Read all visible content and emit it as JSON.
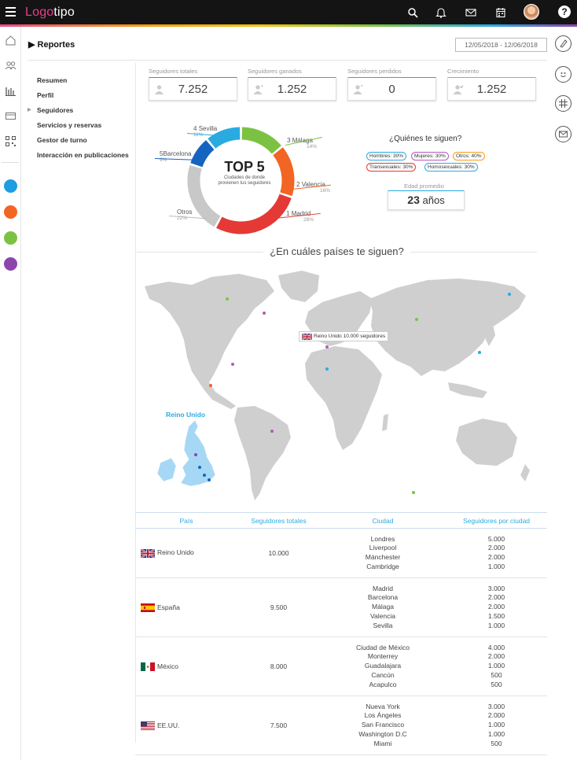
{
  "app": {
    "logo_part1": "Logo",
    "logo_part2": "tipo"
  },
  "topbar": {
    "icons": [
      "search-icon",
      "bell-icon",
      "mail-icon",
      "calendar-icon",
      "avatar",
      "help-icon"
    ],
    "help_label": "?"
  },
  "header": {
    "section": "Reportes",
    "date_range": "12/05/2018 - 12/06/2018"
  },
  "menu": {
    "items": [
      {
        "label": "Resumen"
      },
      {
        "label": "Perfil"
      },
      {
        "label": "Seguidores",
        "active": true
      },
      {
        "label": "Servicios y reservas"
      },
      {
        "label": "Gestor de turno"
      },
      {
        "label": "Interacción en publicaciones"
      }
    ]
  },
  "stats": [
    {
      "label": "Seguidores totales",
      "value": "7.252",
      "color": "#b35bb8"
    },
    {
      "label": "Seguidores ganados",
      "value": "1.252",
      "color": "#29abe2"
    },
    {
      "label": "Seguidores perdidos",
      "value": "0",
      "color": "#f26522"
    },
    {
      "label": "Crecimiento",
      "value": "1.252",
      "color": "#8dc63f"
    }
  ],
  "top5": {
    "title": "TOP 5",
    "subtitle_1": "Ciudades de donde",
    "subtitle_2": "provienen tus seguidores",
    "cities": [
      {
        "rank": "3",
        "name": "Málaga",
        "pct": "14%",
        "color": "#7cc242"
      },
      {
        "rank": "2",
        "name": "Valencia",
        "pct": "16%",
        "color": "#f26522"
      },
      {
        "rank": "1",
        "name": "Madrid",
        "pct": "28%",
        "color": "#e53935"
      },
      {
        "rank": "",
        "name": "Otros",
        "pct": "22%",
        "color": "#c8c8c8"
      },
      {
        "rank": "5",
        "name": "Barcelona",
        "pct": "9%",
        "color": "#1565c0"
      },
      {
        "rank": "4",
        "name": "Sevilla",
        "pct": "11%",
        "color": "#29abe2"
      }
    ]
  },
  "who": {
    "title": "¿Quiénes te siguen?",
    "pills": [
      {
        "label": "Hombres: 30%",
        "color": "#29abe2"
      },
      {
        "label": "Mujeres: 30%",
        "color": "#b35bb8"
      },
      {
        "label": "Otros: 40%",
        "color": "#f39c12"
      },
      {
        "label": "Transexuales: 30%",
        "color": "#e53935"
      },
      {
        "label": "Homosexuales: 30%",
        "color": "#29abe2"
      }
    ],
    "age_label": "Edad promedio",
    "age_value": "23",
    "age_unit": "años"
  },
  "map": {
    "title": "¿En cuáles países te siguen?",
    "tooltip": "Reino Unido 10.000 seguidores",
    "inset_title": "Reino Unido"
  },
  "table": {
    "headers": [
      "País",
      "Seguidores totales",
      "Ciudad",
      "Seguidores por ciudad"
    ],
    "rows": [
      {
        "pais": "Reino Unido",
        "flag": "uk",
        "total": "10.000",
        "ciudades": [
          "Londres",
          "Liverpool",
          "Mánchester",
          "Cambridge"
        ],
        "valores": [
          "5.000",
          "2.000",
          "2.000",
          "1.000"
        ]
      },
      {
        "pais": "España",
        "flag": "es",
        "total": "9.500",
        "ciudades": [
          "Madrid",
          "Barcelona",
          "Málaga",
          "Valencia",
          "Sevilla"
        ],
        "valores": [
          "3.000",
          "2.000",
          "2.000",
          "1.500",
          "1.000"
        ]
      },
      {
        "pais": "México",
        "flag": "mx",
        "total": "8.000",
        "ciudades": [
          "Ciudad de México",
          "Monterrey",
          "Guadalajara",
          "Cancún",
          "Acapulco"
        ],
        "valores": [
          "4.000",
          "2.000",
          "1.000",
          "500",
          "500"
        ]
      },
      {
        "pais": "EE.UU.",
        "flag": "us",
        "total": "7.500",
        "ciudades": [
          "Nueva York",
          "Los Ángeles",
          "San Francisco",
          "Washington D.C",
          "Miami"
        ],
        "valores": [
          "3.000",
          "2.000",
          "1.000",
          "1.000",
          "500"
        ]
      }
    ]
  }
}
